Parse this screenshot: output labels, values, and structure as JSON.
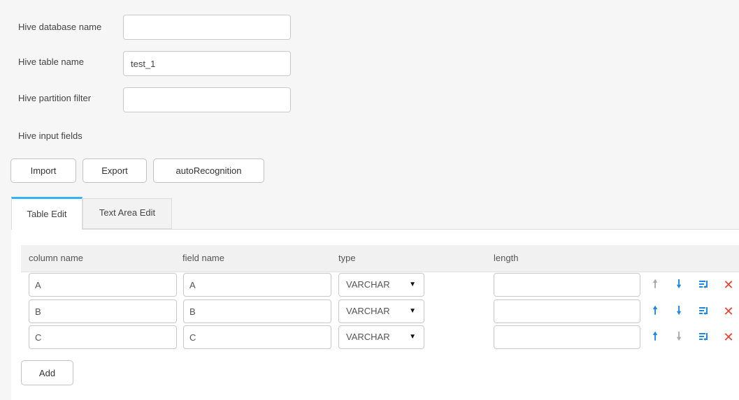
{
  "form": {
    "db_label": "Hive database name",
    "db_value": "",
    "table_label": "Hive table name",
    "table_value": "test_1",
    "partition_label": "Hive partition filter",
    "partition_value": "",
    "fields_label": "Hive input fields"
  },
  "buttons": {
    "import": "Import",
    "export": "Export",
    "auto": "autoRecognition",
    "add": "Add"
  },
  "tabs": {
    "table_edit": "Table Edit",
    "text_area_edit": "Text Area Edit"
  },
  "table": {
    "headers": [
      "column name",
      "field name",
      "type",
      "length"
    ],
    "rows": [
      {
        "column": "A",
        "field": "A",
        "type": "VARCHAR",
        "length": ""
      },
      {
        "column": "B",
        "field": "B",
        "type": "VARCHAR",
        "length": ""
      },
      {
        "column": "C",
        "field": "C",
        "type": "VARCHAR",
        "length": ""
      }
    ]
  },
  "icons": {
    "move_up": "arrow-up-icon",
    "move_down": "arrow-down-icon",
    "insert": "insert-row-icon",
    "delete": "delete-icon",
    "dropdown": "caret-down-icon"
  },
  "colors": {
    "accent": "#34b4ee",
    "action_blue": "#1e88e5",
    "disabled_gray": "#aaaaaa",
    "delete_red": "#e8412c"
  }
}
